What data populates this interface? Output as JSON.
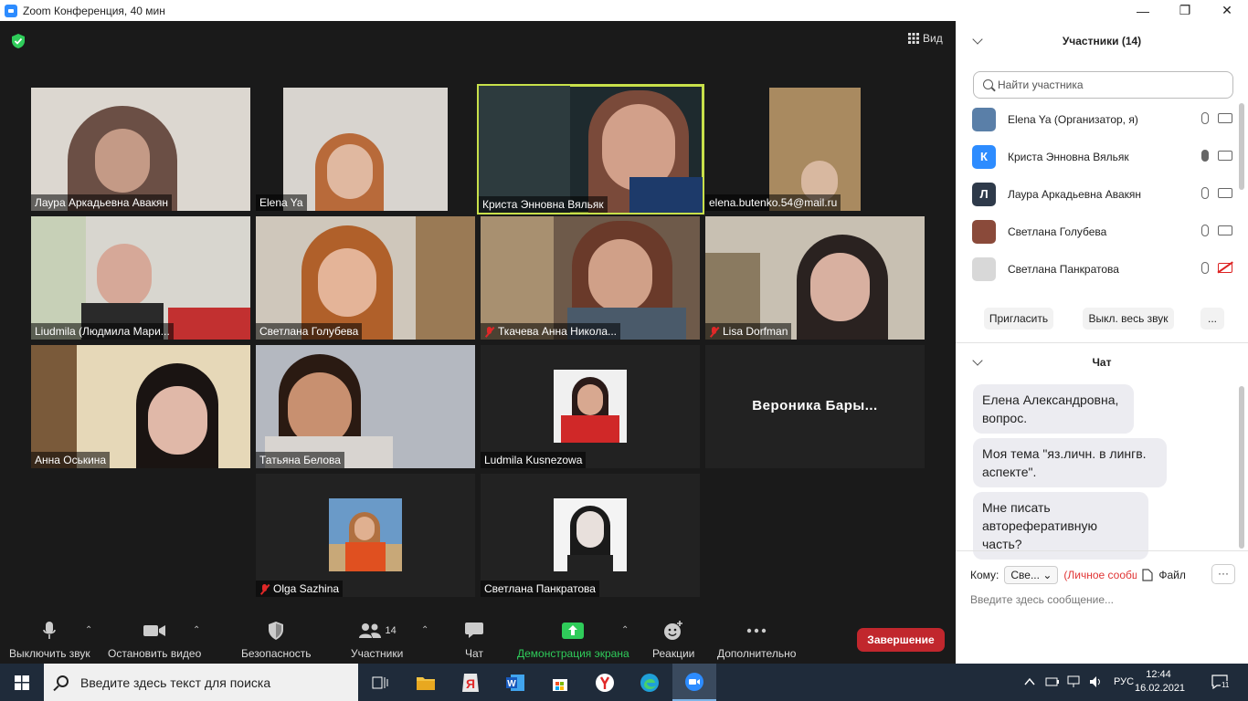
{
  "window": {
    "title": "Zoom Конференция, 40 мин"
  },
  "view_button": "Вид",
  "tiles": [
    {
      "name": "Лаура Аркадьевна Авакян",
      "muted": false,
      "active": false
    },
    {
      "name": "Elena Ya",
      "muted": false,
      "active": false
    },
    {
      "name": "Криста Энновна Вяльяк",
      "muted": false,
      "active": true
    },
    {
      "name": "elena.butenko.54@mail.ru",
      "muted": false,
      "active": false
    },
    {
      "name": "Liudmila (Людмила Мари...",
      "muted": false,
      "active": false
    },
    {
      "name": "Светлана Голубева",
      "muted": false,
      "active": false
    },
    {
      "name": "Ткачева Анна Никола...",
      "muted": true,
      "active": false
    },
    {
      "name": "Lisa Dorfman",
      "muted": true,
      "active": false
    },
    {
      "name": "Анна Оськина",
      "muted": false,
      "active": false
    },
    {
      "name": "Татьяна Белова",
      "muted": false,
      "active": false
    },
    {
      "name": "Ludmila Kusnezowa",
      "muted": false,
      "active": false
    },
    {
      "name": "Вероника Бары...",
      "muted": false,
      "active": false
    },
    {
      "name": "Olga Sazhina",
      "muted": true,
      "active": false
    },
    {
      "name": "Светлана Панкратова",
      "muted": false,
      "active": false
    }
  ],
  "toolbar": {
    "mute": "Выключить звук",
    "video": "Остановить видео",
    "security": "Безопасность",
    "participants": "Участники",
    "participants_count": "14",
    "chat": "Чат",
    "share": "Демонстрация экрана",
    "reactions": "Реакции",
    "more": "Дополнительно",
    "end": "Завершение"
  },
  "participants_panel": {
    "title": "Участники (14)",
    "search_placeholder": "Найти участника",
    "list": [
      {
        "name": "Elena Ya (Организатор, я)",
        "initial": "",
        "color": "#5a7fa8"
      },
      {
        "name": "Криста Энновна Вяльяк",
        "initial": "К",
        "color": "#2d8cff"
      },
      {
        "name": "Лаура Аркадьевна Авакян",
        "initial": "Л",
        "color": "#2e3a4a"
      },
      {
        "name": "Светлана Голубева",
        "initial": "",
        "color": "#8a4a3a"
      },
      {
        "name": "Светлана Панкратова",
        "initial": "",
        "color": "#d8d8d8"
      }
    ],
    "invite": "Пригласить",
    "mute_all": "Выкл. весь звук",
    "more": "..."
  },
  "chat_panel": {
    "title": "Чат",
    "messages": [
      "Елена Александровна, вопрос.",
      "Моя тема \"яз.личн. в лингв. аспекте\".",
      "Мне писать автореферативную часть?"
    ],
    "to_label": "Кому:",
    "to_value": "Све...",
    "private_label": "(Личное сообщение)",
    "file_label": "Файл",
    "more": "···",
    "input_placeholder": "Введите здесь сообщение..."
  },
  "taskbar": {
    "search_placeholder": "Введите здесь текст для поиска",
    "lang": "РУС",
    "time": "12:44",
    "date": "16.02.2021",
    "notifications": "11"
  },
  "colors": {
    "accent_blue": "#2d8cff",
    "end_red": "#c1272d",
    "share_green": "#2fcc5a",
    "active_speaker": "#c8e04a"
  }
}
